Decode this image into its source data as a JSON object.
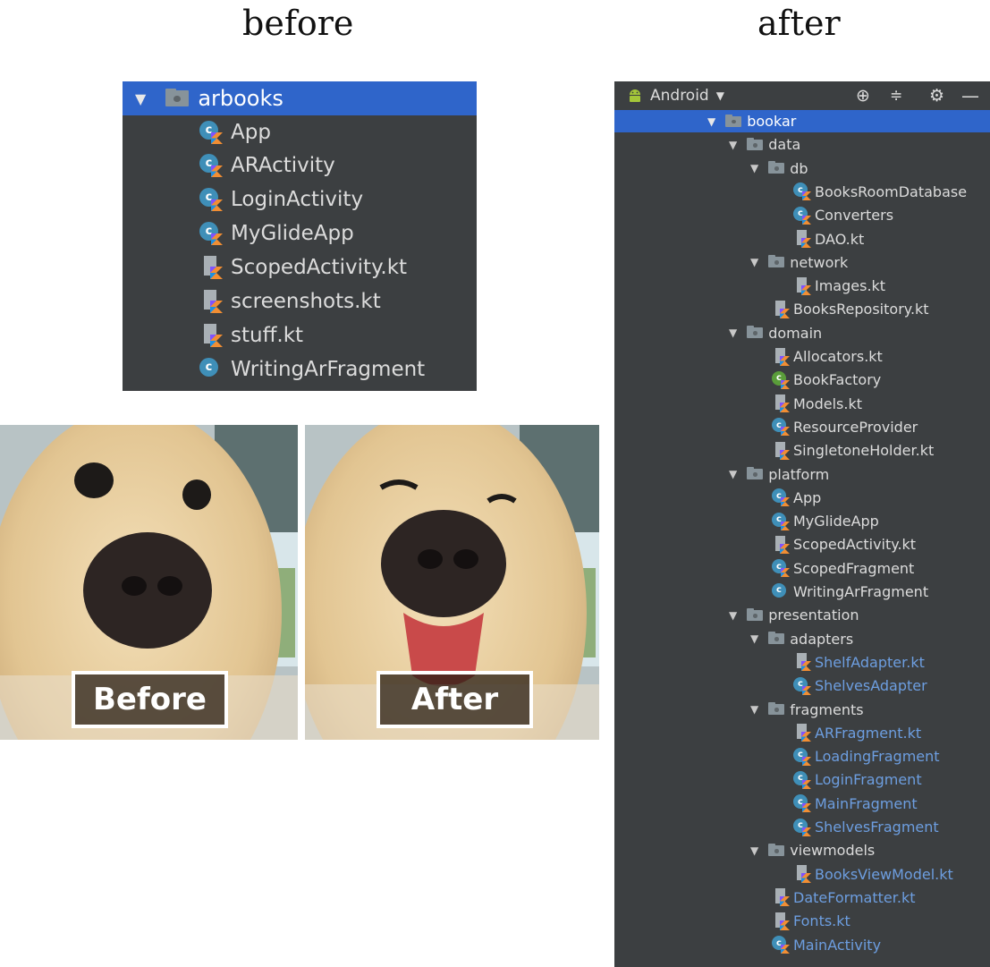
{
  "titles": {
    "before": "before",
    "after": "after"
  },
  "before_panel": {
    "root": "arbooks",
    "items": [
      {
        "label": "App",
        "icon": "kotlin-class-icon"
      },
      {
        "label": "ARActivity",
        "icon": "kotlin-class-icon"
      },
      {
        "label": "LoginActivity",
        "icon": "kotlin-class-icon"
      },
      {
        "label": "MyGlideApp",
        "icon": "kotlin-class-icon"
      },
      {
        "label": "ScopedActivity.kt",
        "icon": "kotlin-file-icon"
      },
      {
        "label": "screenshots.kt",
        "icon": "kotlin-file-icon"
      },
      {
        "label": "stuff.kt",
        "icon": "kotlin-file-icon"
      },
      {
        "label": "WritingArFragment",
        "icon": "java-class-icon"
      }
    ]
  },
  "photos": {
    "before_label": "Before",
    "after_label": "After"
  },
  "after_panel": {
    "view_selector": "Android",
    "toolbar_icons": [
      "locate-icon",
      "collapse-icon",
      "gear-icon",
      "minimize-icon"
    ],
    "tree": [
      {
        "label": "bookar",
        "type": "folder",
        "depth": 0,
        "selected": true
      },
      {
        "label": "data",
        "type": "folder",
        "depth": 1
      },
      {
        "label": "db",
        "type": "folder",
        "depth": 2
      },
      {
        "label": "BooksRoomDatabase",
        "type": "kt-class",
        "depth": 3
      },
      {
        "label": "Converters",
        "type": "kt-class",
        "depth": 3
      },
      {
        "label": "DAO.kt",
        "type": "kt-file",
        "depth": 3
      },
      {
        "label": "network",
        "type": "folder",
        "depth": 2
      },
      {
        "label": "Images.kt",
        "type": "kt-file",
        "depth": 3
      },
      {
        "label": "BooksRepository.kt",
        "type": "kt-file",
        "depth": 2
      },
      {
        "label": "domain",
        "type": "folder",
        "depth": 1
      },
      {
        "label": "Allocators.kt",
        "type": "kt-file",
        "depth": 2
      },
      {
        "label": "BookFactory",
        "type": "kt-class-green",
        "depth": 2
      },
      {
        "label": "Models.kt",
        "type": "kt-file",
        "depth": 2
      },
      {
        "label": "ResourceProvider",
        "type": "kt-class",
        "depth": 2
      },
      {
        "label": "SingletoneHolder.kt",
        "type": "kt-file",
        "depth": 2
      },
      {
        "label": "platform",
        "type": "folder",
        "depth": 1
      },
      {
        "label": "App",
        "type": "kt-class",
        "depth": 2
      },
      {
        "label": "MyGlideApp",
        "type": "kt-class",
        "depth": 2
      },
      {
        "label": "ScopedActivity.kt",
        "type": "kt-file",
        "depth": 2
      },
      {
        "label": "ScopedFragment",
        "type": "kt-class",
        "depth": 2
      },
      {
        "label": "WritingArFragment",
        "type": "java-class",
        "depth": 2
      },
      {
        "label": "presentation",
        "type": "folder",
        "depth": 1
      },
      {
        "label": "adapters",
        "type": "folder",
        "depth": 2
      },
      {
        "label": "ShelfAdapter.kt",
        "type": "kt-file",
        "depth": 3,
        "modified": true
      },
      {
        "label": "ShelvesAdapter",
        "type": "kt-class",
        "depth": 3,
        "modified": true
      },
      {
        "label": "fragments",
        "type": "folder",
        "depth": 2
      },
      {
        "label": "ARFragment.kt",
        "type": "kt-file",
        "depth": 3,
        "modified": true
      },
      {
        "label": "LoadingFragment",
        "type": "kt-class",
        "depth": 3,
        "modified": true
      },
      {
        "label": "LoginFragment",
        "type": "kt-class",
        "depth": 3,
        "modified": true
      },
      {
        "label": "MainFragment",
        "type": "kt-class",
        "depth": 3,
        "modified": true
      },
      {
        "label": "ShelvesFragment",
        "type": "kt-class",
        "depth": 3,
        "modified": true
      },
      {
        "label": "viewmodels",
        "type": "folder",
        "depth": 2
      },
      {
        "label": "BooksViewModel.kt",
        "type": "kt-file",
        "depth": 3,
        "modified": true
      },
      {
        "label": "DateFormatter.kt",
        "type": "kt-file",
        "depth": 2,
        "modified": true
      },
      {
        "label": "Fonts.kt",
        "type": "kt-file",
        "depth": 2,
        "modified": true
      },
      {
        "label": "MainActivity",
        "type": "kt-class",
        "depth": 2,
        "modified": true
      }
    ]
  },
  "colors": {
    "panel_bg": "#3c3f41",
    "selection": "#2f65ca",
    "modified_text": "#6d9ee0",
    "kotlin_class": "#3f8fb8"
  }
}
